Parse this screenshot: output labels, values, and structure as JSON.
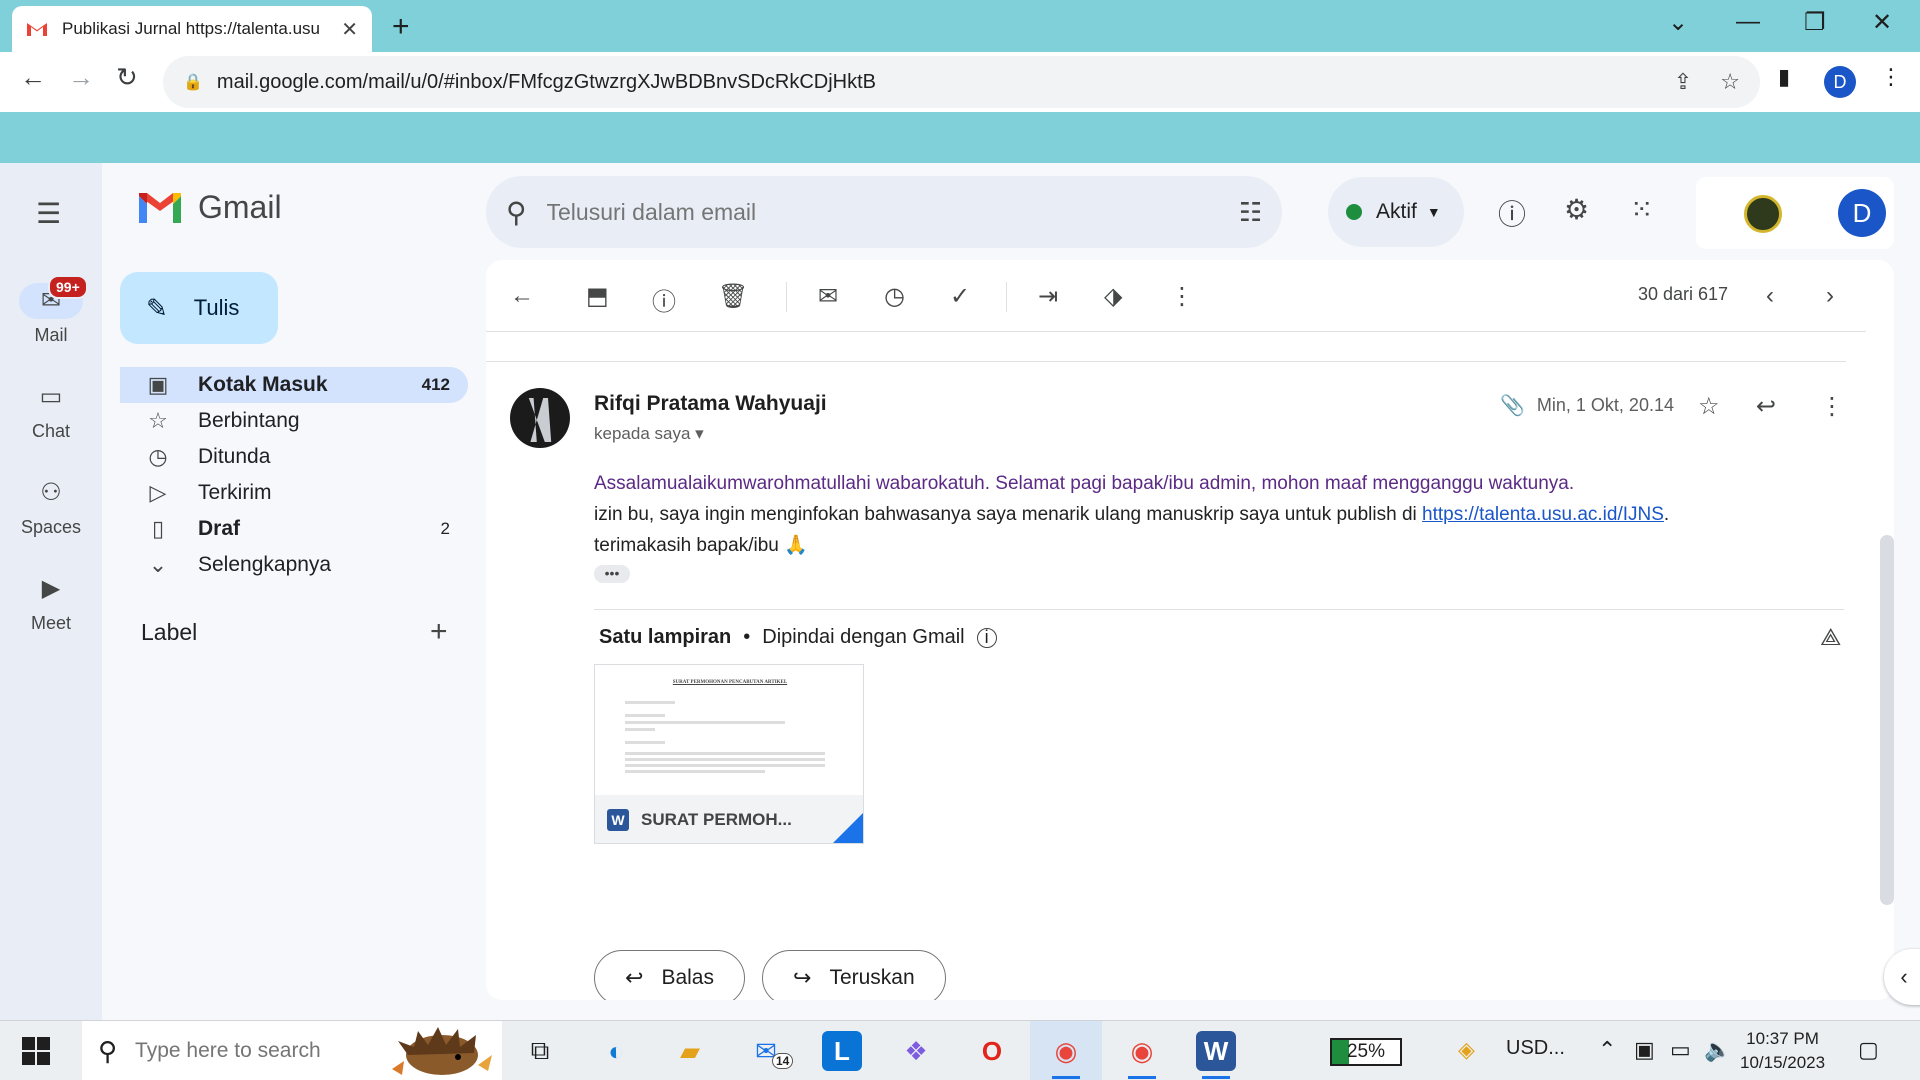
{
  "browser": {
    "tab_title": "Publikasi Jurnal https://talenta.usu",
    "url": "mail.google.com/mail/u/0/#inbox/FMfcgzGtwzrgXJwBDBnvSDcRkCDjHktB",
    "profile_initial": "D"
  },
  "gmail": {
    "logo_text": "Gmail",
    "rail": {
      "mail": "Mail",
      "mail_badge": "99+",
      "chat": "Chat",
      "spaces": "Spaces",
      "meet": "Meet"
    },
    "compose_label": "Tulis",
    "nav": [
      {
        "label": "Kotak Masuk",
        "count": "412"
      },
      {
        "label": "Berbintang",
        "count": ""
      },
      {
        "label": "Ditunda",
        "count": ""
      },
      {
        "label": "Terkirim",
        "count": ""
      },
      {
        "label": "Draf",
        "count": "2"
      },
      {
        "label": "Selengkapnya",
        "count": ""
      }
    ],
    "label_heading": "Label",
    "search_placeholder": "Telusuri dalam email",
    "status": "Aktif",
    "account_initial": "D",
    "pager": "30 dari 617"
  },
  "message": {
    "sender": "Rifqi Pratama Wahyuaji",
    "to": "kepada saya",
    "date": "Min, 1 Okt, 20.14",
    "line1": "Assalamualaikumwarohmatullahi wabarokatuh. Selamat pagi bapak/ibu admin, mohon maaf mengganggu waktunya.",
    "line2_prefix": "izin bu, saya ingin menginfokan bahwasanya saya menarik ulang manuskrip saya untuk publish di ",
    "line2_link": "https://talenta.usu.ac.id/IJNS",
    "line2_suffix": ".",
    "line3": "terimakasih bapak/ibu  🙏",
    "attachments_title": "Satu lampiran",
    "attachments_scan": "Dipindai dengan Gmail",
    "attachment_name": "SURAT PERMOH...",
    "doc_title": "SURAT PERMOHONAN PENCABUTAN ARTIKEL",
    "reply_label": "Balas",
    "forward_label": "Teruskan"
  },
  "taskbar": {
    "search_placeholder": "Type here to search",
    "mail_badge": "14",
    "battery": "25%",
    "currency": "USD...",
    "time": "10:37 PM",
    "date": "10/15/2023"
  },
  "colors": {
    "gmail_red": "#ea4335",
    "chrome_frame": "#7fd0d9",
    "accent_blue": "#1a56c8",
    "active_nav": "#d3e3fd"
  }
}
